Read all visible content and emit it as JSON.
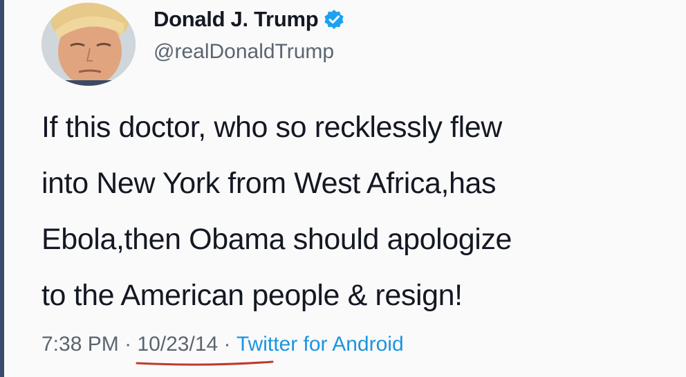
{
  "tweet": {
    "display_name": "Donald J. Trump",
    "handle": "@realDonaldTrump",
    "text_lines": [
      "If this doctor, who so recklessly flew",
      "into New York from West Africa,has",
      "Ebola,then Obama should apologize",
      "to the American people & resign!"
    ],
    "time": "7:38 PM",
    "separator": " · ",
    "date": "10/23/14",
    "source": "Twitter for Android"
  },
  "icons": {
    "verified": "verified-badge-icon",
    "avatar": "profile-photo"
  },
  "colors": {
    "verified_badge": "#1da1f2",
    "source_link": "#1b95e0",
    "date_underline": "#c0392b"
  }
}
